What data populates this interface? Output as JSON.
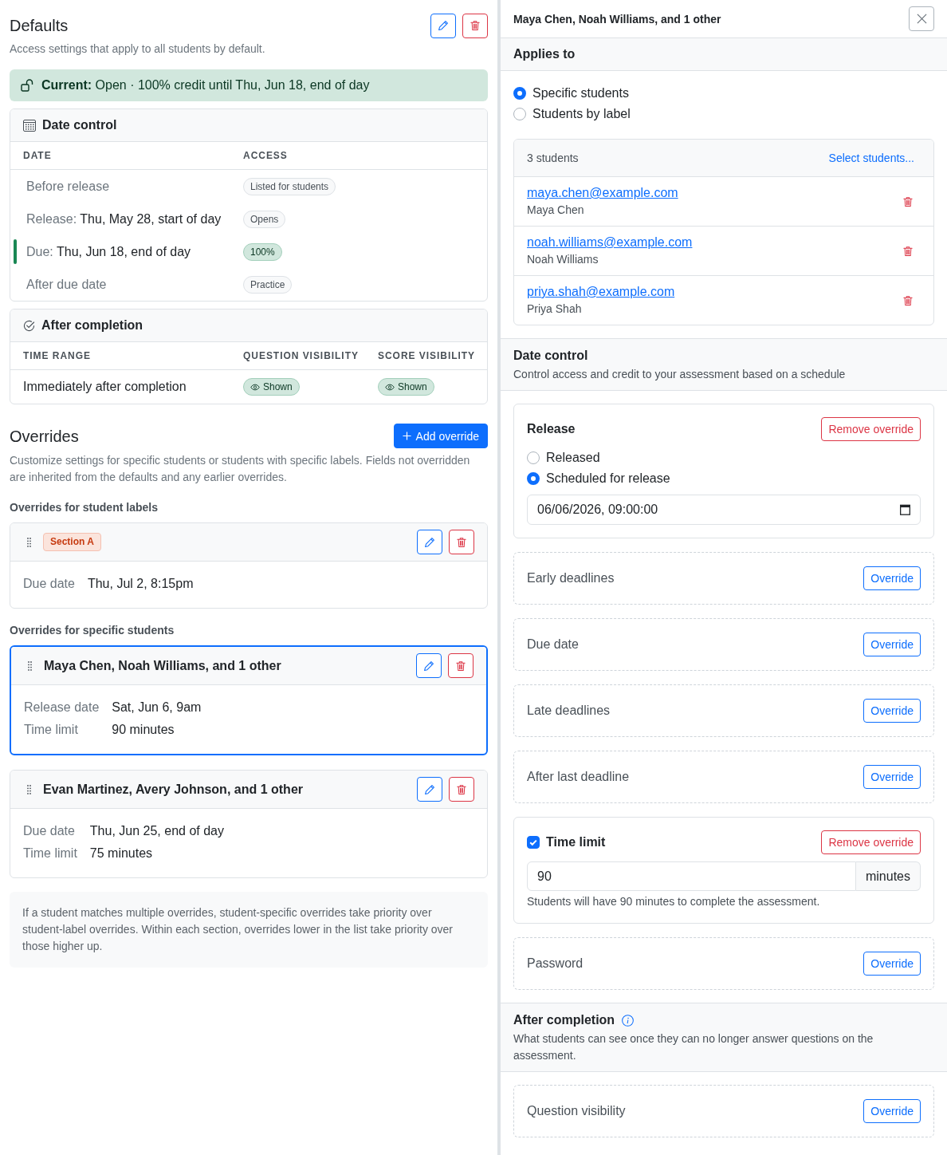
{
  "defaults": {
    "title": "Defaults",
    "description": "Access settings that apply to all students by default.",
    "current_status": "**Current:** Open · 100% credit until Thu, Jun 18, end of day",
    "date_control": {
      "title": "Date control",
      "columns": [
        "DATE",
        "ACCESS"
      ],
      "rows": [
        {
          "label": "Before release",
          "access": {
            "text": "Listed for students",
            "kind": "neutral"
          },
          "current": false
        },
        {
          "label": "Release:",
          "value": "Thu, May 28, start of day",
          "access": {
            "text": "Opens",
            "kind": "neutral"
          },
          "current": false
        },
        {
          "label": "Due:",
          "value": "Thu, Jun 18, end of day",
          "access": {
            "text": "100%",
            "kind": "success"
          },
          "current": true
        },
        {
          "label": "After due date",
          "access": {
            "text": "Practice",
            "kind": "neutral"
          },
          "current": false
        }
      ]
    },
    "after_completion": {
      "title": "After completion",
      "columns": [
        "TIME RANGE",
        "QUESTION VISIBILITY",
        "SCORE VISIBILITY"
      ],
      "rows": [
        {
          "time_range": "Immediately after completion",
          "question_visibility": "Shown",
          "score_visibility": "Shown"
        }
      ]
    }
  },
  "overrides": {
    "title": "Overrides",
    "add_button": "Add override",
    "description": "Customize settings for specific students or students with specific labels. Fields not overridden are inherited from the defaults and any earlier overrides.",
    "label_heading": "Overrides for student labels",
    "label_overrides": [
      {
        "label": "Section A",
        "selected": false,
        "fields": [
          {
            "label": "Due date",
            "value": "Thu, Jul 2, 8:15pm"
          }
        ]
      }
    ],
    "student_heading": "Overrides for specific students",
    "student_overrides": [
      {
        "title": "Maya Chen, Noah Williams, and 1 other",
        "selected": true,
        "fields": [
          {
            "label": "Release date",
            "value": "Sat, Jun 6, 9am"
          },
          {
            "label": "Time limit",
            "value": "90 minutes"
          }
        ]
      },
      {
        "title": "Evan Martinez, Avery Johnson, and 1 other",
        "selected": false,
        "fields": [
          {
            "label": "Due date",
            "value": "Thu, Jun 25, end of day"
          },
          {
            "label": "Time limit",
            "value": "75 minutes"
          }
        ]
      }
    ],
    "note": "If a student matches multiple overrides, student-specific overrides take priority over student-label overrides. Within each section, overrides lower in the list take priority over those higher up."
  },
  "editor": {
    "title": "Maya Chen, Noah Williams, and 1 other",
    "applies_to": {
      "heading": "Applies to",
      "options": [
        {
          "label": "Specific students",
          "selected": true
        },
        {
          "label": "Students by label",
          "selected": false
        }
      ],
      "student_count": "3 students",
      "select_link": "Select students...",
      "students": [
        {
          "email": "maya.chen@example.com",
          "name": "Maya Chen"
        },
        {
          "email": "noah.williams@example.com",
          "name": "Noah Williams"
        },
        {
          "email": "priya.shah@example.com",
          "name": "Priya Shah"
        }
      ]
    },
    "date_control": {
      "heading": "Date control",
      "description": "Control access and credit to your assessment based on a schedule",
      "settings": [
        {
          "kind": "schedule",
          "title": "Release",
          "remove_button": "Remove override",
          "options": [
            {
              "label": "Released",
              "selected": false
            },
            {
              "label": "Scheduled for release",
              "selected": true
            }
          ],
          "value": "06/06/2026, 09:00:00"
        },
        {
          "kind": "inherited",
          "title": "Early deadlines",
          "button": "Override"
        },
        {
          "kind": "inherited",
          "title": "Due date",
          "button": "Override"
        },
        {
          "kind": "inherited",
          "title": "Late deadlines",
          "button": "Override"
        },
        {
          "kind": "inherited",
          "title": "After last deadline",
          "button": "Override"
        },
        {
          "kind": "duration",
          "title": "Time limit",
          "checked": true,
          "remove_button": "Remove override",
          "value": "90",
          "unit": "minutes",
          "help": "Students will have 90 minutes to complete the assessment."
        },
        {
          "kind": "inherited",
          "title": "Password",
          "button": "Override"
        }
      ]
    },
    "after_completion": {
      "heading": "After completion",
      "description": "What students can see once they can no longer answer questions on the assessment.",
      "settings": [
        {
          "kind": "inherited",
          "title": "Question visibility",
          "button": "Override"
        }
      ]
    }
  }
}
